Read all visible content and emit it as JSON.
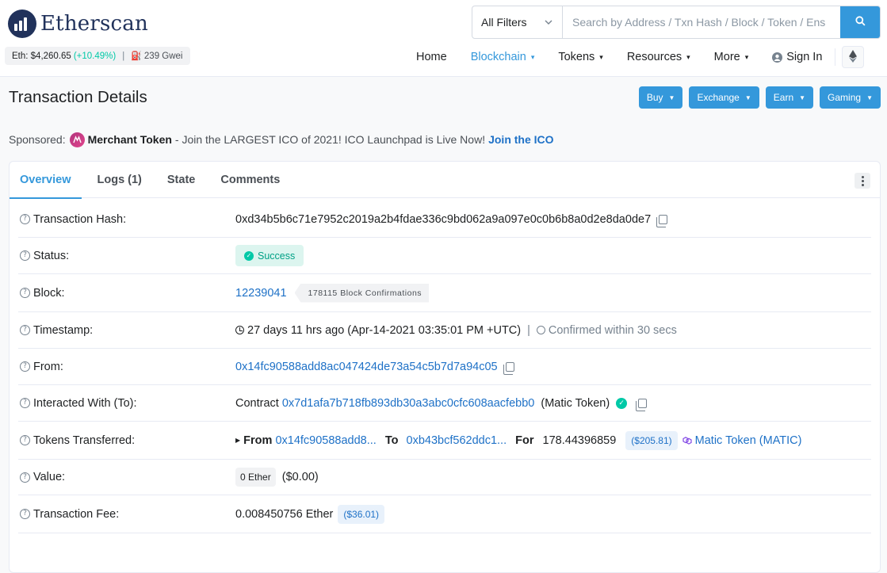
{
  "header": {
    "logo_text": "Etherscan",
    "eth_price_label": "Eth: $4,260.65",
    "eth_price_change": "(+10.49%)",
    "gas_label": "239 Gwei",
    "search": {
      "filter_label": "All Filters",
      "placeholder": "Search by Address / Txn Hash / Block / Token / Ens"
    },
    "nav": {
      "home": "Home",
      "blockchain": "Blockchain",
      "tokens": "Tokens",
      "resources": "Resources",
      "more": "More",
      "sign_in": "Sign In"
    }
  },
  "page": {
    "title": "Transaction Details",
    "buttons": {
      "buy": "Buy",
      "exchange": "Exchange",
      "earn": "Earn",
      "gaming": "Gaming"
    }
  },
  "sponsored": {
    "label": "Sponsored:",
    "brand": "Merchant Token",
    "text": "- Join the LARGEST ICO of 2021! ICO Launchpad is Live Now!",
    "cta": "Join the ICO"
  },
  "tabs": {
    "overview": "Overview",
    "logs": "Logs (1)",
    "state": "State",
    "comments": "Comments"
  },
  "details": {
    "tx_hash_label": "Transaction Hash:",
    "tx_hash": "0xd34b5b6c71e7952c2019a2b4fdae336c9bd062a9a097e0c0b6b8a0d2e8da0de7",
    "status_label": "Status:",
    "status": "Success",
    "block_label": "Block:",
    "block": "12239041",
    "block_confirmations": "178115 Block Confirmations",
    "timestamp_label": "Timestamp:",
    "timestamp": "27 days 11 hrs ago (Apr-14-2021 03:35:01 PM +UTC)",
    "confirmed_within": "Confirmed within 30 secs",
    "from_label": "From:",
    "from": "0x14fc90588add8ac047424de73a54c5b7d7a94c05",
    "to_label": "Interacted With (To):",
    "to_prefix": "Contract",
    "to_address": "0x7d1afa7b718fb893db30a3abc0cfc608aacfebb0",
    "to_name": "(Matic Token)",
    "tokens_label": "Tokens Transferred:",
    "tokens": {
      "from_label": "From",
      "from_address": "0x14fc90588add8...",
      "to_label": "To",
      "to_address": "0xb43bcf562ddc1...",
      "for_label": "For",
      "amount": "178.44396859",
      "usd": "($205.81)",
      "token": "Matic Token (MATIC)"
    },
    "value_label": "Value:",
    "value": "0 Ether",
    "value_usd": "($0.00)",
    "fee_label": "Transaction Fee:",
    "fee": "0.008450756 Ether",
    "fee_usd": "($36.01)"
  },
  "icons": {
    "logo": "etherscan-logo-icon",
    "search": "search-icon",
    "ethereum": "ethereum-icon",
    "user": "user-icon",
    "gas": "gas-pump-icon",
    "help": "question-circle-icon",
    "copy": "copy-icon",
    "check": "check-circle-icon",
    "clock": "clock-icon",
    "timer": "stopwatch-icon",
    "matic": "matic-token-icon",
    "kebab": "more-vertical-icon"
  },
  "colors": {
    "accent": "#3498db",
    "link": "#1e71c7",
    "success": "#00c9a7",
    "brand_dark": "#21325b"
  }
}
